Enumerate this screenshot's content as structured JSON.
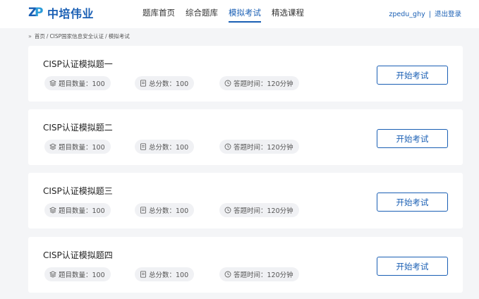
{
  "header": {
    "logo_mark_z": "Z",
    "logo_mark_p": "P",
    "logo_text": "中培伟业",
    "nav": [
      {
        "label": "题库首页",
        "active": false
      },
      {
        "label": "综合题库",
        "active": false
      },
      {
        "label": "模拟考试",
        "active": true
      },
      {
        "label": "精选课程",
        "active": false
      }
    ],
    "username": "zpedu_ghy",
    "separator": "|",
    "logout": "退出登录"
  },
  "breadcrumb": {
    "icon": "double-chevron-right-icon",
    "items": [
      "首页",
      "CISP国家信息安全认证",
      "模拟考试"
    ],
    "separator": "/"
  },
  "exams": [
    {
      "title": "CISP认证模拟题一",
      "count": "题目数量：100",
      "score": "总分数：100",
      "time": "答题时间：120分钟",
      "button": "开始考试"
    },
    {
      "title": "CISP认证模拟题二",
      "count": "题目数量：100",
      "score": "总分数：100",
      "time": "答题时间：120分钟",
      "button": "开始考试"
    },
    {
      "title": "CISP认证模拟题三",
      "count": "题目数量：100",
      "score": "总分数：100",
      "time": "答题时间：120分钟",
      "button": "开始考试"
    },
    {
      "title": "CISP认证模拟题四",
      "count": "题目数量：100",
      "score": "总分数：100",
      "time": "答题时间：120分钟",
      "button": "开始考试"
    }
  ],
  "colors": {
    "accent": "#1a5fb4",
    "background": "#f4f5f7",
    "pill_bg": "#f0f1f4"
  },
  "icons": {
    "count": "layers-icon",
    "score": "document-icon",
    "time": "clock-icon"
  }
}
